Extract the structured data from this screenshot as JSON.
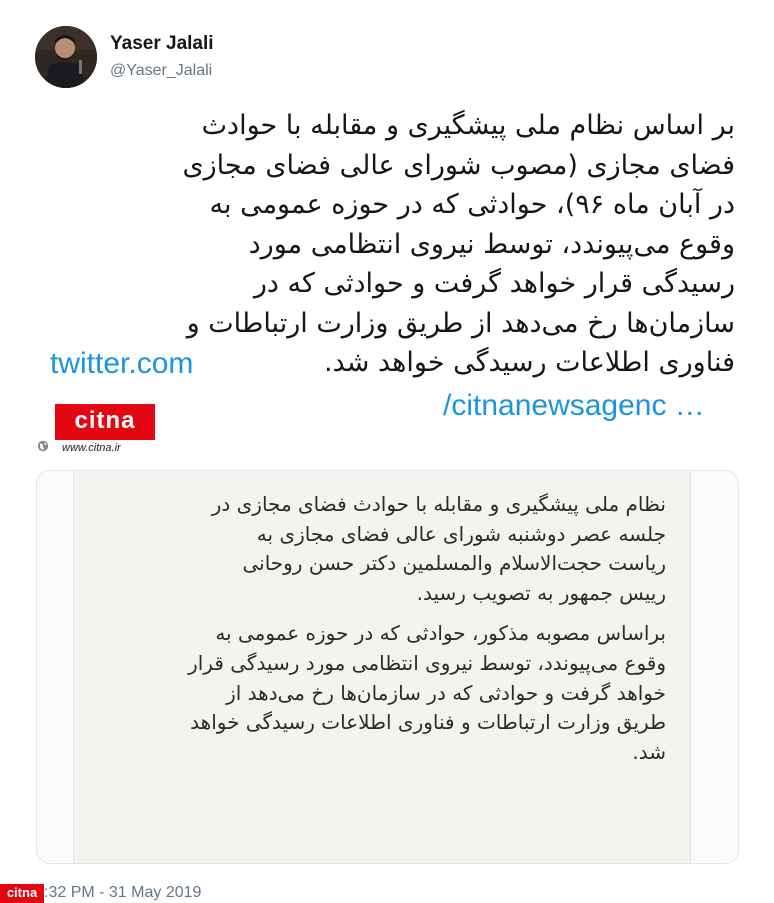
{
  "author": {
    "name": "Yaser Jalali",
    "handle": "@Yaser_Jalali"
  },
  "tweet": {
    "lines": [
      "بر اساس نظام ملی پیشگیری و مقابله با حوادث",
      "فضای مجازی (مصوب شورای عالی فضای مجازی",
      "در آبان ماه ۹۶)، حوادثی که در حوزه عمومی به",
      "وقوع می‌پیوندد، توسط نیروی انتظامی مورد",
      "رسیدگی قرار خواهد گرفت و حوادثی که در",
      "سازمان‌ها رخ می‌دهد از طریق وزارت ارتباطات و",
      "فناوری اطلاعات رسیدگی خواهد شد."
    ],
    "link_part1": "twitter.com",
    "link_part2": "/citnanewsagenc …"
  },
  "citna": {
    "logo_text": "citna",
    "url": "www.citna.ir"
  },
  "card": {
    "para1": [
      "نظام ملی پیشگیری و مقابله با حوادث فضای مجازی در",
      "جلسه عصر دوشنبه شورای عالی فضای مجازی به",
      "ریاست حجت‌الاسلام والمسلمین دکتر حسن روحانی",
      "رییس جمهور به تصویب رسید."
    ],
    "para2": [
      "براساس مصوبه مذکور، حوادثی که در حوزه عمومی به",
      "وقوع می‌پیوندد، توسط نیروی انتظامی مورد رسیدگی قرار",
      "خواهد گرفت و حوادثی که در سازمان‌ها رخ می‌دهد از",
      "طریق وزارت ارتباطات و فناوری اطلاعات رسیدگی خواهد",
      "شد."
    ]
  },
  "footer": {
    "logo_text": "citna",
    "timestamp": ":32 PM - 31 May 2019"
  },
  "colors": {
    "link": "#1b95e0",
    "brand_red": "#e30613",
    "muted": "#657786"
  },
  "icons": [
    "globe-icon"
  ]
}
